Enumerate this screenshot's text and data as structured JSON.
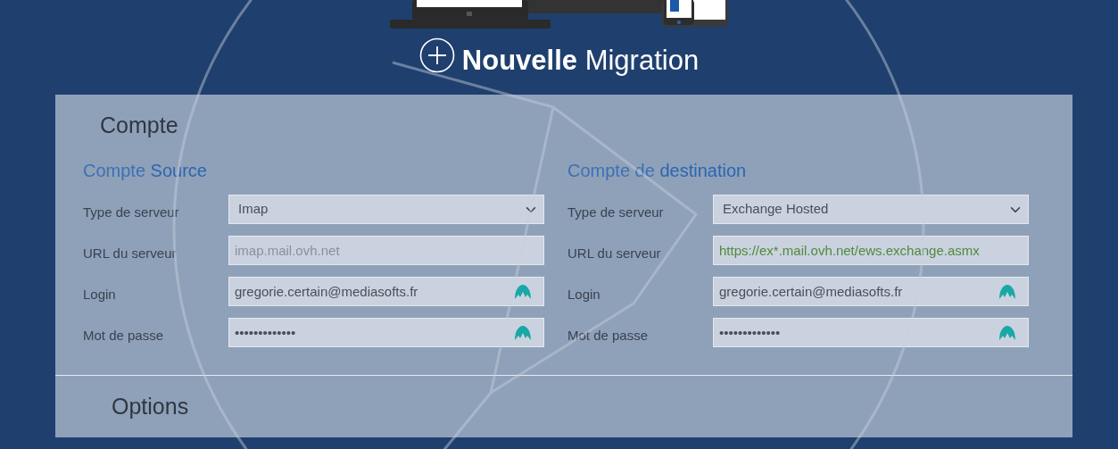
{
  "header": {
    "title": "**Nouvelle** Migration"
  },
  "sections": [
    {
      "title": "Compte",
      "columns": [
        {
          "heading": "Compte **Source**",
          "fields": [
            {
              "label": "Type de serveur",
              "kind": "select",
              "value": "Imap"
            },
            {
              "label": "URL du serveur",
              "kind": "text",
              "placeholder": "imap.mail.ovh.net",
              "icon": false,
              "validated": false
            },
            {
              "label": "Login",
              "kind": "text",
              "value": "gregorie.certain@mediasofts.fr",
              "icon": true,
              "validated": false
            },
            {
              "label": "Mot de passe",
              "kind": "text",
              "value": "•••••••••••••",
              "icon": true,
              "validated": false
            }
          ]
        },
        {
          "heading": "Compte de **destination**",
          "fields": [
            {
              "label": "Type de serveur",
              "kind": "select",
              "value": "Exchange Hosted"
            },
            {
              "label": "URL du serveur",
              "kind": "text",
              "value": "https://ex*.mail.ovh.net/ews.exchange.asmx",
              "icon": false,
              "validated": true
            },
            {
              "label": "Login",
              "kind": "text",
              "value": "gregorie.certain@mediasofts.fr",
              "icon": true,
              "validated": false
            },
            {
              "label": "Mot de passe",
              "kind": "text",
              "value": "•••••••••••••",
              "icon": true,
              "validated": false
            }
          ]
        }
      ]
    },
    {
      "title": "Options"
    }
  ]
}
